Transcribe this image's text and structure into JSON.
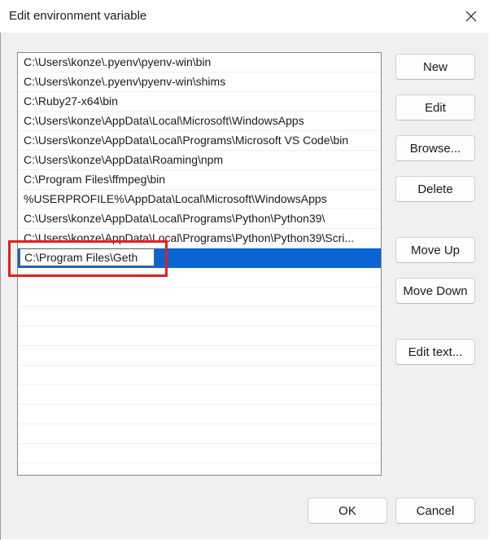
{
  "window": {
    "title": "Edit environment variable"
  },
  "list": {
    "items": [
      "C:\\Users\\konze\\.pyenv\\pyenv-win\\bin",
      "C:\\Users\\konze\\.pyenv\\pyenv-win\\shims",
      "C:\\Ruby27-x64\\bin",
      "C:\\Users\\konze\\AppData\\Local\\Microsoft\\WindowsApps",
      "C:\\Users\\konze\\AppData\\Local\\Programs\\Microsoft VS Code\\bin",
      "C:\\Users\\konze\\AppData\\Roaming\\npm",
      "C:\\Program Files\\ffmpeg\\bin",
      "%USERPROFILE%\\AppData\\Local\\Microsoft\\WindowsApps",
      "C:\\Users\\konze\\AppData\\Local\\Programs\\Python\\Python39\\",
      "C:\\Users\\konze\\AppData\\Local\\Programs\\Python\\Python39\\Scri..."
    ],
    "editing_value": "C:\\Program Files\\Geth",
    "selection_color": "#0a64d2",
    "annotation_color": "#e0201e"
  },
  "buttons": {
    "new": "New",
    "edit": "Edit",
    "browse": "Browse...",
    "delete": "Delete",
    "move_up": "Move Up",
    "move_down": "Move Down",
    "edit_text": "Edit text...",
    "ok": "OK",
    "cancel": "Cancel"
  }
}
